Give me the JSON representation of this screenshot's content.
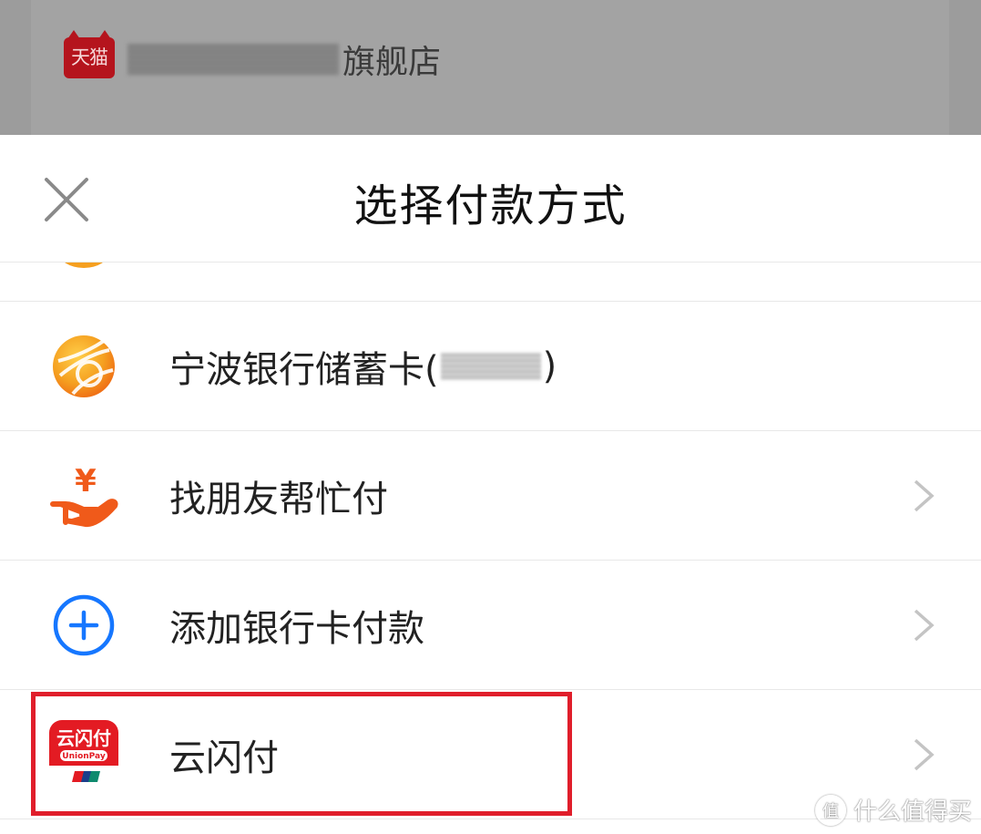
{
  "background": {
    "store_logo_text": "天猫",
    "store_name_suffix": "旗舰店"
  },
  "sheet": {
    "title": "选择付款方式",
    "methods": [
      {
        "label": "宁波银行储蓄卡(",
        "label_suffix": ")",
        "icon": "ningbo-bank-icon",
        "has_chevron": false
      },
      {
        "label": "找朋友帮忙付",
        "icon": "friend-pay-icon",
        "has_chevron": true
      },
      {
        "label": "添加银行卡付款",
        "icon": "add-card-icon",
        "has_chevron": true
      },
      {
        "label": "云闪付",
        "icon": "unionpay-quickpass-icon",
        "has_chevron": true,
        "icon_text": "云闪付",
        "icon_subtext": "UnionPay"
      }
    ]
  },
  "watermark": {
    "logo": "值",
    "text": "什么值得买"
  },
  "colors": {
    "highlight": "#e01e2b",
    "accent_blue": "#1677ff",
    "friend_pay_orange": "#f05a1a",
    "ningbo_orange": "#f5a020"
  }
}
